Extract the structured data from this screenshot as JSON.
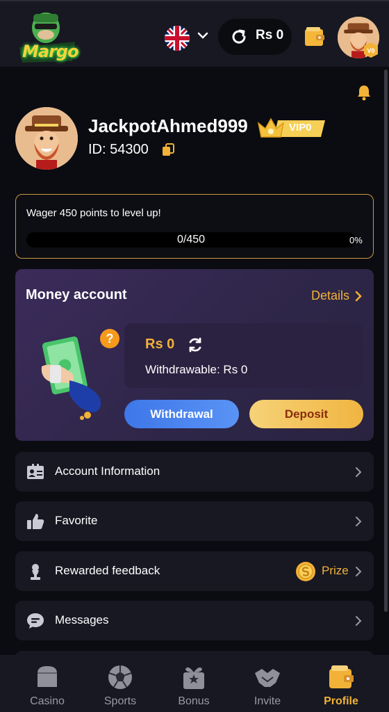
{
  "header": {
    "logo_text": "Margo",
    "language": "English (UK flag)",
    "balance": "Rs 0",
    "avatar_badge": "V0"
  },
  "profile": {
    "username": "JackpotAhmed999",
    "vip_label": "VIP0",
    "id_text": "ID: 54300"
  },
  "level": {
    "wager_text": "Wager 450 points to level up!",
    "progress_label": "0/450",
    "progress_percent": "0%",
    "progress_fraction": 0
  },
  "money_account": {
    "title": "Money account",
    "details_label": "Details",
    "help_label": "?",
    "balance": "Rs 0",
    "withdrawable": "Withdrawable:  Rs 0",
    "withdraw_button": "Withdrawal",
    "deposit_button": "Deposit"
  },
  "menu": {
    "account_information": "Account Information",
    "favorite": "Favorite",
    "rewarded_feedback": "Rewarded feedback",
    "prize_label": "Prize",
    "messages": "Messages"
  },
  "bottom_nav": {
    "casino": "Casino",
    "sports": "Sports",
    "bonus": "Bonus",
    "invite": "Invite",
    "profile": "Profile"
  },
  "colors": {
    "accent_gold": "#f2b237",
    "background": "#0b0c11",
    "card": "#171822",
    "money_card": "#3b2b5a",
    "withdraw_blue": "#3e77e8",
    "deposit_gold": "#f0b541"
  }
}
